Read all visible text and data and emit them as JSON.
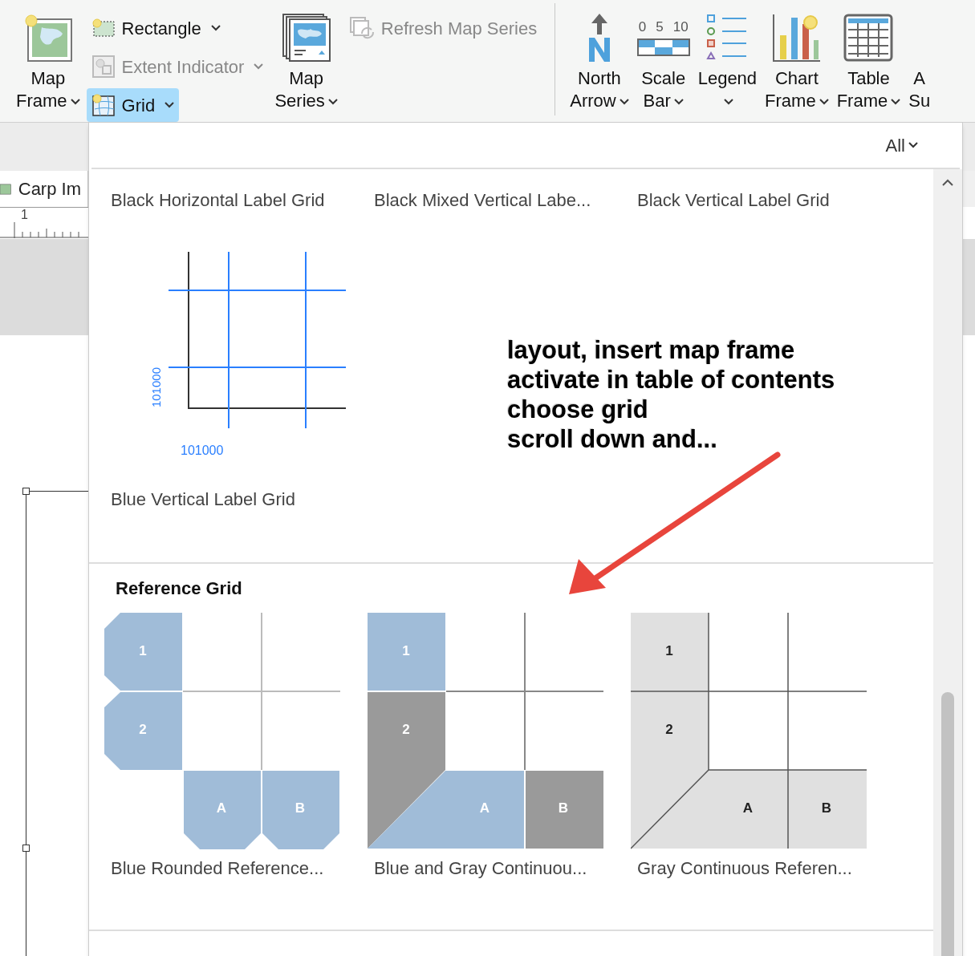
{
  "ribbon": {
    "groups": [
      {
        "kind": "large",
        "lines": [
          "Map",
          "Frame"
        ],
        "dropdown": true,
        "disabled": false,
        "selected": false
      },
      {
        "kind": "stack",
        "items": [
          {
            "label": "Rectangle",
            "dropdown": true,
            "disabled": false,
            "selected": false
          },
          {
            "label": "Extent Indicator",
            "dropdown": true,
            "disabled": true,
            "selected": false
          },
          {
            "label": "Grid",
            "dropdown": true,
            "disabled": false,
            "selected": true
          }
        ]
      },
      {
        "kind": "large",
        "lines": [
          "Map",
          "Series"
        ],
        "dropdown": true,
        "disabled": false,
        "selected": false
      },
      {
        "kind": "stack",
        "items": [
          {
            "label": "Refresh Map Series",
            "dropdown": false,
            "disabled": true,
            "selected": false
          }
        ]
      },
      {
        "kind": "separator"
      },
      {
        "kind": "large",
        "lines": [
          "North",
          "Arrow"
        ],
        "dropdown": true,
        "disabled": false,
        "selected": false
      },
      {
        "kind": "large",
        "lines": [
          "Scale",
          "Bar"
        ],
        "dropdown": true,
        "disabled": false,
        "selected": false
      },
      {
        "kind": "large",
        "lines": [
          "Legend"
        ],
        "dropdown": true,
        "disabled": false,
        "selected": false
      },
      {
        "kind": "large",
        "lines": [
          "Chart",
          "Frame"
        ],
        "dropdown": true,
        "disabled": false,
        "selected": false
      },
      {
        "kind": "large",
        "lines": [
          "Table",
          "Frame"
        ],
        "dropdown": true,
        "disabled": false,
        "selected": false
      },
      {
        "kind": "large",
        "lines": [
          "A",
          "Su"
        ],
        "dropdown": false,
        "disabled": false,
        "selected": false
      }
    ]
  },
  "scale_bar_icon_labels": [
    "0",
    "5",
    "10"
  ],
  "document_tab": {
    "label": "Carp Im"
  },
  "ruler": {
    "label": "1"
  },
  "gallery": {
    "filter": "All",
    "top_items": [
      "Black Horizontal Label Grid",
      "Black Mixed Vertical Labe...",
      "Black Vertical Label Grid"
    ],
    "preview_item": {
      "label": "Blue Vertical Label Grid",
      "x_label": "101000",
      "y_label": "101000"
    },
    "sections": [
      {
        "title": "Reference Grid",
        "items": [
          {
            "kind": "blue_rounded",
            "label": "Blue Rounded Reference...",
            "cells": [
              "1",
              "2",
              "A",
              "B"
            ]
          },
          {
            "kind": "blue_gray",
            "label": "Blue and Gray Continuou...",
            "cells": [
              "1",
              "2",
              "A",
              "B"
            ]
          },
          {
            "kind": "gray",
            "label": "Gray Continuous Referen...",
            "cells": [
              "1",
              "2",
              "A",
              "B"
            ]
          }
        ]
      }
    ]
  },
  "annotation": {
    "lines": [
      "layout, insert map frame",
      "activate in table of contents",
      "choose grid",
      "scroll down and..."
    ]
  }
}
